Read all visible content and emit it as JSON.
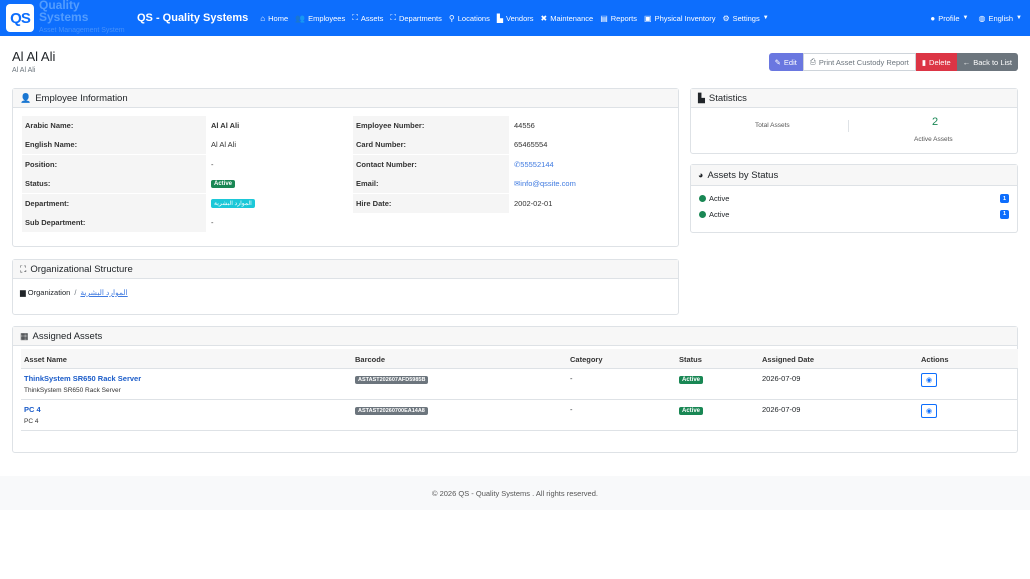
{
  "brand": {
    "logo": "QS",
    "name": "Quality Systems",
    "tagline": "Asset Management System",
    "app_title": "QS - Quality Systems"
  },
  "nav": {
    "items": [
      {
        "icon": "home-icon",
        "glyph": "⌂",
        "label": "Home"
      },
      {
        "icon": "users-icon",
        "glyph": "👥",
        "label": "Employees"
      },
      {
        "icon": "sitemap-icon",
        "glyph": "⛶",
        "label": "Assets"
      },
      {
        "icon": "sitemap-icon",
        "glyph": "⛶",
        "label": "Departments"
      },
      {
        "icon": "location-pin-icon",
        "glyph": "⚲",
        "label": "Locations"
      },
      {
        "icon": "industry-icon",
        "glyph": "▙",
        "label": "Vendors"
      },
      {
        "icon": "tools-icon",
        "glyph": "✖",
        "label": "Maintenance"
      },
      {
        "icon": "chart-icon",
        "glyph": "▤",
        "label": "Reports"
      },
      {
        "icon": "clipboard-icon",
        "glyph": "▣",
        "label": "Physical Inventory"
      },
      {
        "icon": "gears-icon",
        "glyph": "⚙",
        "label": "Settings"
      }
    ],
    "profile": "Profile",
    "language": "English"
  },
  "page": {
    "title": "Al Al Ali",
    "subtitle": "Al Al Ali"
  },
  "actions": {
    "edit": "Edit",
    "print": "Print Asset Custody Report",
    "delete": "Delete",
    "back": "Back to List"
  },
  "employee_info": {
    "header": "Employee Information",
    "left": [
      {
        "label": "Arabic Name:",
        "value": "Al Al Ali",
        "type": "bold"
      },
      {
        "label": "English Name:",
        "value": "Al Al Ali",
        "type": "text"
      },
      {
        "label": "Position:",
        "value": "-",
        "type": "text"
      },
      {
        "label": "Status:",
        "value": "Active",
        "type": "badge"
      },
      {
        "label": "Department:",
        "value": "الموارد البشرية",
        "type": "dept"
      },
      {
        "label": "Sub Department:",
        "value": "-",
        "type": "text"
      }
    ],
    "right": [
      {
        "label": "Employee Number:",
        "value": "44556",
        "type": "text"
      },
      {
        "label": "Card Number:",
        "value": "65465554",
        "type": "text"
      },
      {
        "label": "Contact Number:",
        "value": "55552144",
        "type": "phone"
      },
      {
        "label": "Email:",
        "value": "info@qssite.com",
        "type": "email"
      },
      {
        "label": "Hire Date:",
        "value": "2002-02-01",
        "type": "text"
      }
    ]
  },
  "statistics": {
    "header": "Statistics",
    "total_label": "Total Assets",
    "active_value": "2",
    "active_label": "Active Assets"
  },
  "assets_by_status": {
    "header": "Assets by Status",
    "rows": [
      {
        "label": "Active",
        "count": "1"
      },
      {
        "label": "Active",
        "count": "1"
      }
    ]
  },
  "org_structure": {
    "header": "Organizational Structure",
    "root": "Organization",
    "sep": "/",
    "dept": "الموارد البشرية"
  },
  "assigned_assets": {
    "header": "Assigned Assets",
    "columns": [
      "Asset Name",
      "Barcode",
      "Category",
      "Status",
      "Assigned Date",
      "Actions"
    ],
    "rows": [
      {
        "name": "ThinkSystem SR650 Rack Server",
        "sub": "ThinkSystem SR650 Rack Server",
        "barcode": "ASTAST202607AFD5985B",
        "category": "-",
        "status": "Active",
        "date": "2026-07-09"
      },
      {
        "name": "PC 4",
        "sub": "PC 4",
        "barcode": "ASTAST20260700EA14A8",
        "category": "-",
        "status": "Active",
        "date": "2026-07-09"
      }
    ]
  },
  "footer": "© 2026 QS - Quality Systems . All rights reserved."
}
